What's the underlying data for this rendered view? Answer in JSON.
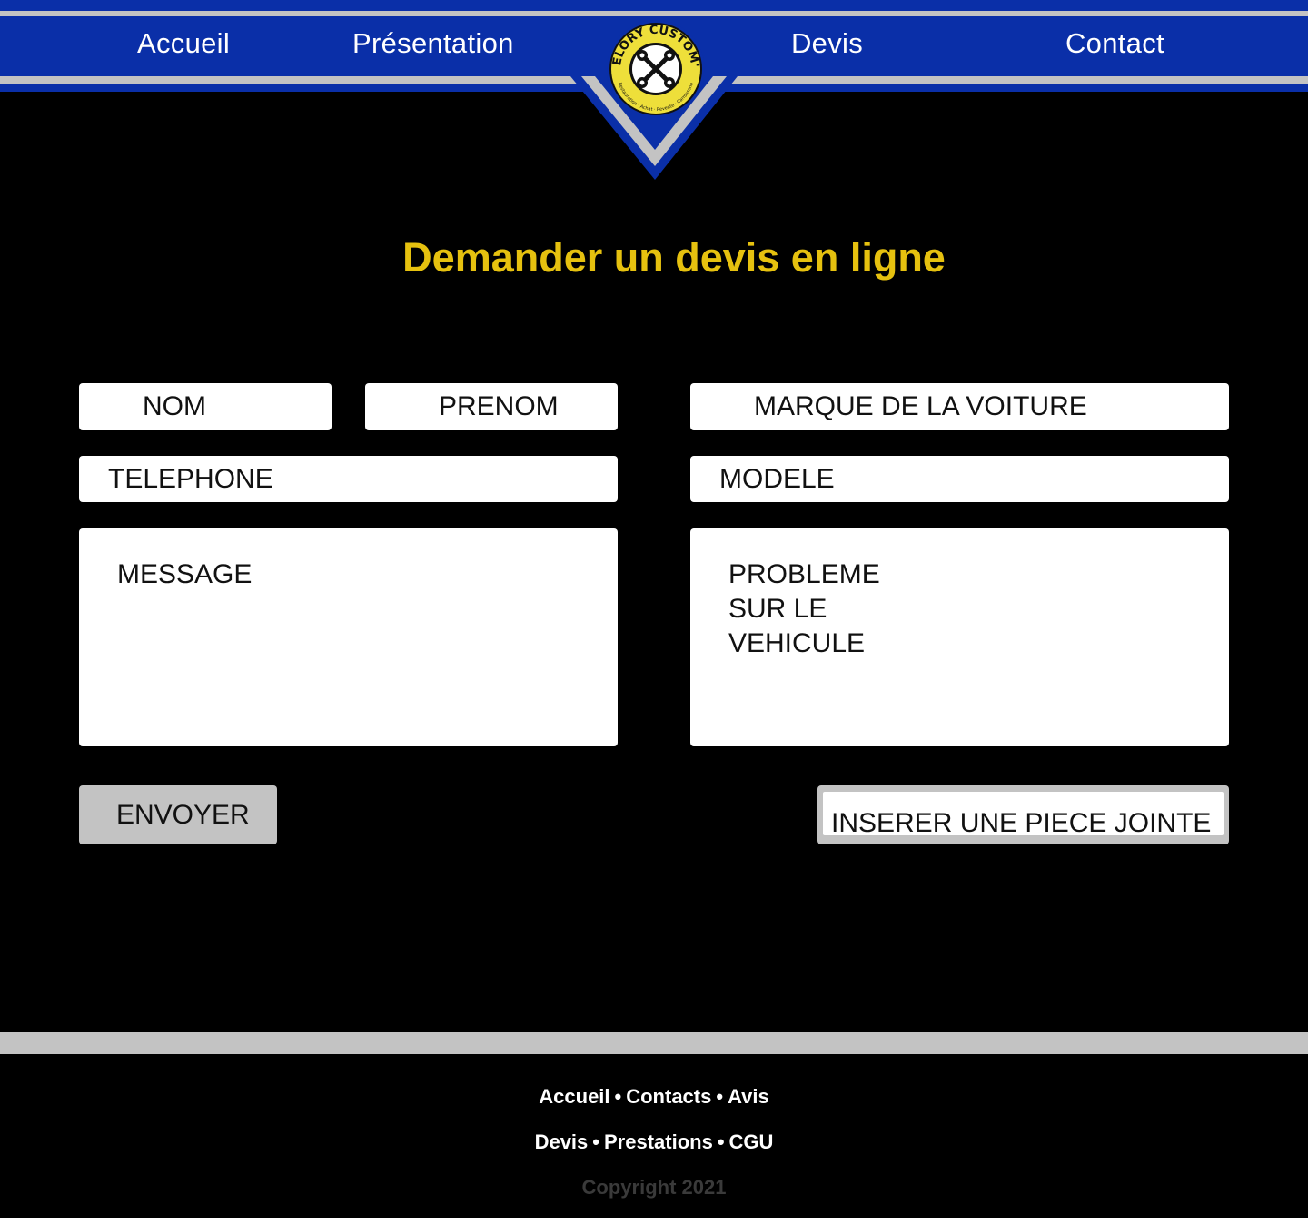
{
  "nav": {
    "accueil": "Accueil",
    "presentation": "Présentation",
    "devis": "Devis",
    "contact": "Contact"
  },
  "logo": {
    "name": "DELORY CUSTOM'S",
    "tagline": "Restauration · Achat · Revente · Carrosserie"
  },
  "page_title": "Demander un devis en ligne",
  "form": {
    "nom": "NOM",
    "prenom": "PRENOM",
    "marque": "MARQUE DE LA VOITURE",
    "telephone": "TELEPHONE",
    "modele": "MODELE",
    "message": "MESSAGE",
    "probleme_lines": [
      "PROBLEME",
      "SUR LE",
      "VEHICULE"
    ],
    "send_label": "ENVOYER",
    "attach_label": "INSERER UNE PIECE JOINTE"
  },
  "footer": {
    "row1": [
      "Accueil",
      "Contacts",
      "Avis"
    ],
    "row2": [
      "Devis",
      "Prestations",
      "CGU"
    ],
    "separator": "•",
    "copyright": "Copyright 2021"
  },
  "colors": {
    "brand_blue": "#0a2fa8",
    "accent_yellow": "#e6c10f",
    "stripe_grey": "#c3c3c3",
    "background": "#000000"
  },
  "icons": [
    "crossed-wrenches-icon"
  ]
}
